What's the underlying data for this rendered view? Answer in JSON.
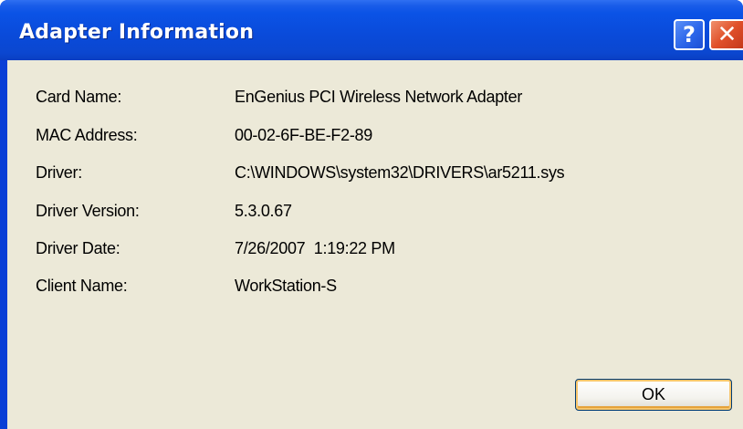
{
  "window": {
    "title": "Adapter Information",
    "help_label": "?",
    "close_label": "✕"
  },
  "info": {
    "rows": [
      {
        "label": "Card Name:",
        "value": "EnGenius PCI Wireless Network Adapter"
      },
      {
        "label": "MAC Address:",
        "value": "00-02-6F-BE-F2-89"
      },
      {
        "label": "Driver:",
        "value": "C:\\WINDOWS\\system32\\DRIVERS\\ar5211.sys"
      },
      {
        "label": "Driver Version:",
        "value": "5.3.0.67"
      },
      {
        "label": "Driver Date:",
        "value": "7/26/2007  1:19:22 PM"
      },
      {
        "label": "Client Name:",
        "value": "WorkStation-S"
      }
    ]
  },
  "buttons": {
    "ok_label": "OK"
  },
  "colors": {
    "titlebar": "#0b53e6",
    "client_background": "#ece9d8",
    "close_button": "#e0502a"
  }
}
